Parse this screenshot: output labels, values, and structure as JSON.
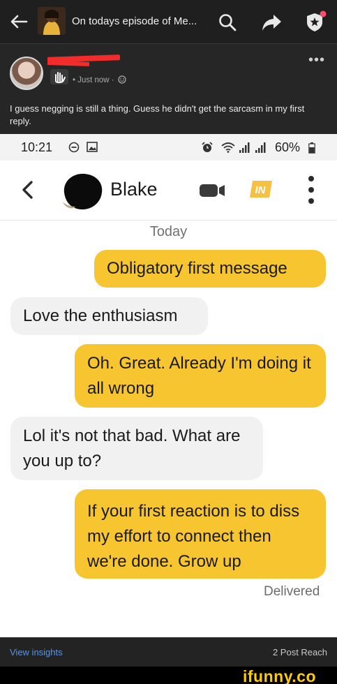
{
  "appbar": {
    "title": "On todays episode of Me..."
  },
  "post": {
    "meta": "• Just now ·",
    "more": "•••",
    "caption": "I guess negging is still a thing. Guess he didn't get the sarcasm in my first reply."
  },
  "status_bar": {
    "time": "10:21",
    "battery": "60%"
  },
  "chat": {
    "contact_name": "Blake",
    "badge_text": "IN",
    "date_divider": "Today",
    "messages": [
      {
        "from": "me",
        "text": "Obligatory first message"
      },
      {
        "from": "them",
        "text": "Love the enthusiasm"
      },
      {
        "from": "me",
        "text": "Oh. Great. Already I'm doing it all wrong"
      },
      {
        "from": "them",
        "text": "Lol it's not that bad. What are you up to?"
      },
      {
        "from": "me",
        "text": "If your first reaction is to diss my effort to connect then we're done. Grow up"
      }
    ],
    "delivery_status": "Delivered"
  },
  "footer": {
    "view_insights": "View insights",
    "reach": "2 Post Reach"
  },
  "watermark": "ifunny.co",
  "colors": {
    "outgoing_bubble": "#f7c52f",
    "incoming_bubble": "#f1f1f1",
    "link_blue": "#5b95e0",
    "watermark_yellow": "#ffcc00",
    "redaction_red": "#f22b2b"
  },
  "icons": [
    "back-arrow-icon",
    "search-icon",
    "share-icon",
    "shield-notification-icon",
    "hand-wave-icon",
    "emoji-icon",
    "dnd-icon",
    "image-icon",
    "alarm-icon",
    "wifi-icon",
    "signal-icon",
    "battery-icon",
    "chevron-left-icon",
    "video-call-icon",
    "kebab-menu-icon"
  ]
}
